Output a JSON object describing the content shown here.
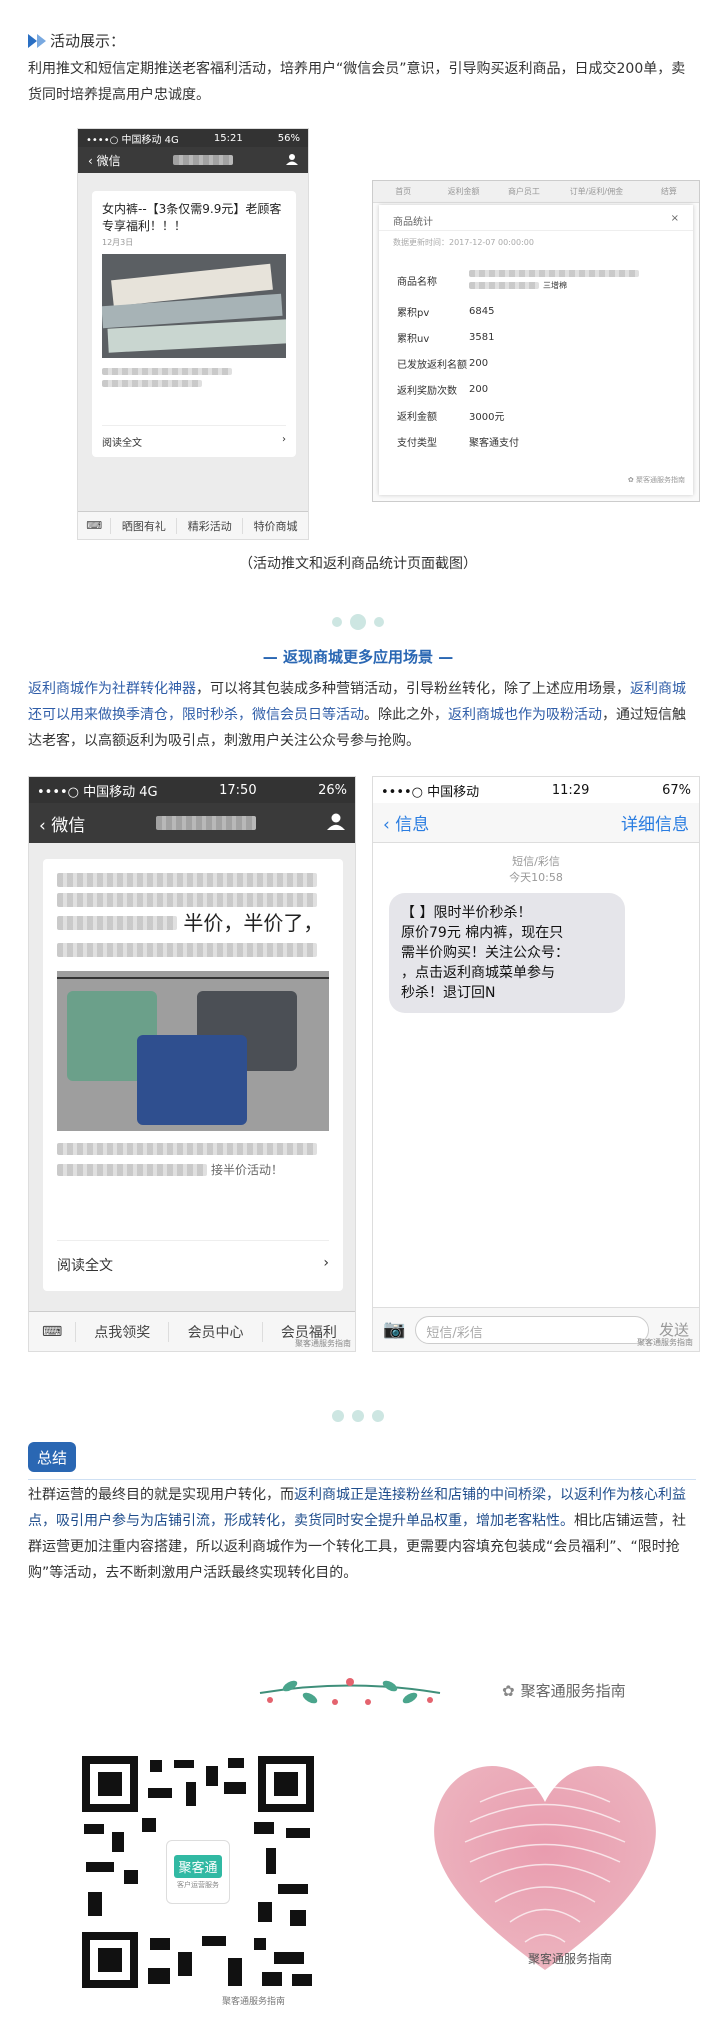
{
  "section1": {
    "heading": "活动展示：",
    "para": "利用推文和短信定期推送老客福利活动，培养用户“微信会员”意识，引导购买返利商品，日成交200单，卖货同时培养提高用户忠诚度。"
  },
  "phone1": {
    "carrier": "••••○ 中国移动 4G",
    "time": "15:21",
    "battery": "56%",
    "back_label": "微信",
    "article_title": "女内裤--【3条仅需9.9元】老顾客专享福利！！！",
    "date": "12月3日",
    "read_more": "阅读全文",
    "tabs": [
      "晒图有礼",
      "精彩活动",
      "特价商城"
    ]
  },
  "stats": {
    "tabs": [
      "首页",
      "返利金额",
      "商户员工",
      "订单/返利/佣金",
      "结算"
    ],
    "title": "商品统计",
    "update_time": "数据更新时间：2017-12-07 00:00:00",
    "rows": [
      {
        "k": "商品名称",
        "v": ""
      },
      {
        "k": "累积pv",
        "v": "6845"
      },
      {
        "k": "累积uv",
        "v": "3581"
      },
      {
        "k": "已发放返利名额",
        "v": "200"
      },
      {
        "k": "返利奖励次数",
        "v": "200"
      },
      {
        "k": "返利金额",
        "v": "3000元"
      },
      {
        "k": "支付类型",
        "v": "聚客通支付"
      }
    ],
    "product_suffix": "三增棉",
    "watermark": "聚客通服务指南"
  },
  "caption1": "（活动推文和返利商品统计页面截图）",
  "section2": {
    "title": "— 返现商城更多应用场景 —",
    "para_parts": [
      {
        "t": "返利商城作为社群转化神器",
        "c": "blue"
      },
      {
        "t": "，可以将其包装成多种营销活动，引导粉丝转化，除了上述应用场景，",
        "c": ""
      },
      {
        "t": "返利商城还可以用来做换季清仓，限时秒杀，微信会员日等活动",
        "c": "blue"
      },
      {
        "t": "。除此之外，",
        "c": ""
      },
      {
        "t": "返利商城也作为吸粉活动",
        "c": "blue"
      },
      {
        "t": "，通过短信触达老客，以高额返利为吸引点，刺激用户关注公众号参与抢购。",
        "c": ""
      }
    ]
  },
  "phone2": {
    "carrier": "••••○ 中国移动 4G",
    "time": "17:50",
    "battery": "26%",
    "back_label": "微信",
    "text_fragment": "半价，半价了，",
    "text_tail": "接半价活动！",
    "read_more": "阅读全文",
    "tabs": [
      "点我领奖",
      "会员中心",
      "会员福利"
    ],
    "watermark": "聚客通服务指南"
  },
  "phone3": {
    "carrier": "••••○ 中国移动",
    "time": "11:29",
    "battery": "67%",
    "back_label": "信息",
    "detail_label": "详细信息",
    "meta1": "短信/彩信",
    "meta2": "今天10:58",
    "sms": "【限时半价秒杀！原价79元棉内裤，现在只需半价购买！关注公众号：，点击返利商城菜单参与秒杀！退订回N",
    "sms_lines": [
      "【           】限时半价秒杀！",
      "原价79元         棉内裤，现在只",
      "需半价购买！关注公众号：",
      "         ，点击返利商城菜单参与",
      "秒杀！退订回N"
    ],
    "input_placeholder": "短信/彩信",
    "send_label": "发送",
    "watermark": "聚客通服务指南"
  },
  "summary": {
    "badge": "总结",
    "para_parts": [
      {
        "t": "社群运营的最终目的就是实现用户转化，而",
        "c": ""
      },
      {
        "t": "返利商城正是连接粉丝和店铺的中间桥梁，以返利作为核心利益点，吸引用户参与为店铺引流，形成转化，卖货同时安全提升单品权重，增加老客粘性。",
        "c": "navy"
      },
      {
        "t": "相比店铺运营，社群运营更加注重内容搭建，所以返利商城作为一个转化工具，更需要内容填充包装成“会员福利”、“限时抢购”等活动，去不断刺激用户活跃最终实现转化目的。",
        "c": ""
      }
    ]
  },
  "footer": {
    "brand": "聚客通服务指南",
    "qr_label": "聚客通",
    "qr_sub": "客户运营服务",
    "watermark": "聚客通服务指南"
  },
  "colors": {
    "accent_blue": "#2f5da8",
    "badge_blue": "#2a67b3",
    "dot_teal": "#cde6e2",
    "heart_pink": "#e8899a"
  }
}
